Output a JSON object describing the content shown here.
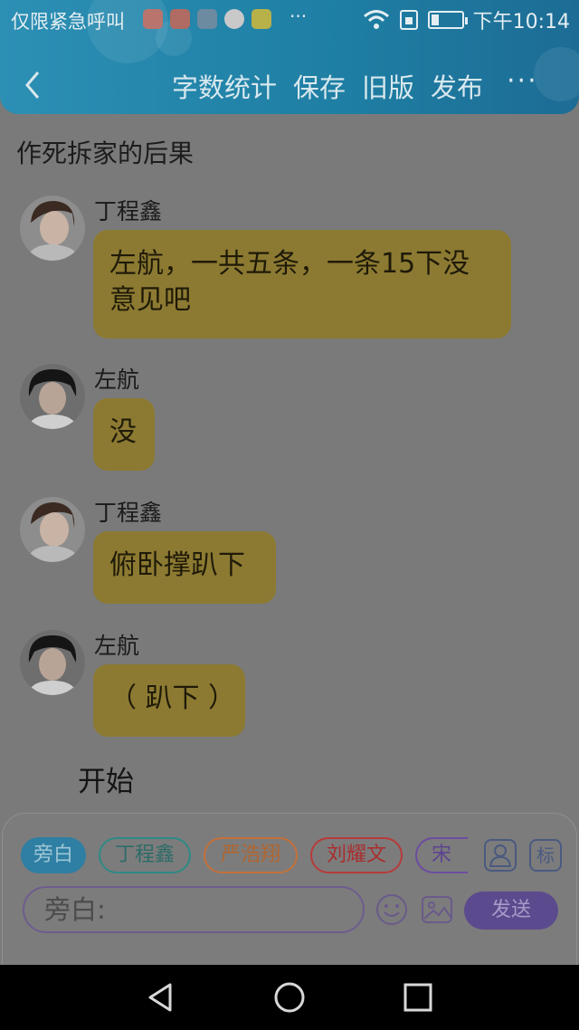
{
  "status": {
    "left_text": "仅限紧急呼叫",
    "dots": "···",
    "time": "下午10:14"
  },
  "nav": {
    "actions": [
      "字数统计",
      "保存",
      "旧版",
      "发布"
    ],
    "more": "···"
  },
  "title": "作死拆家的后果",
  "messages": [
    {
      "sender": "丁程鑫",
      "text": "左航，一共五条，一条15下没意见吧"
    },
    {
      "sender": "左航",
      "text": "没"
    },
    {
      "sender": "丁程鑫",
      "text": "俯卧撑趴下"
    },
    {
      "sender": "左航",
      "text": "（ 趴下 ）"
    }
  ],
  "narration": "开始",
  "composer": {
    "chips": [
      "旁白",
      "丁程鑫",
      "严浩翔",
      "刘耀文",
      "宋亚"
    ],
    "square_label": "标",
    "input_placeholder": "旁白:",
    "send_label": "发送"
  },
  "colors": {
    "header": "#1e7ea3",
    "bubble": "#8c7a32",
    "send": "#5c4a8e",
    "chip_narration": "#2e7fa3",
    "chip_ding": "#2d8a84",
    "chip_yan": "#c4703a",
    "chip_liu": "#b83a3a",
    "chip_song": "#6c4ca0"
  },
  "icons": [
    "back-icon",
    "more-icon",
    "smiley-icon",
    "image-icon",
    "person-icon",
    "wifi-icon",
    "battery-icon",
    "back-triangle-icon",
    "home-circle-icon",
    "recent-square-icon"
  ]
}
